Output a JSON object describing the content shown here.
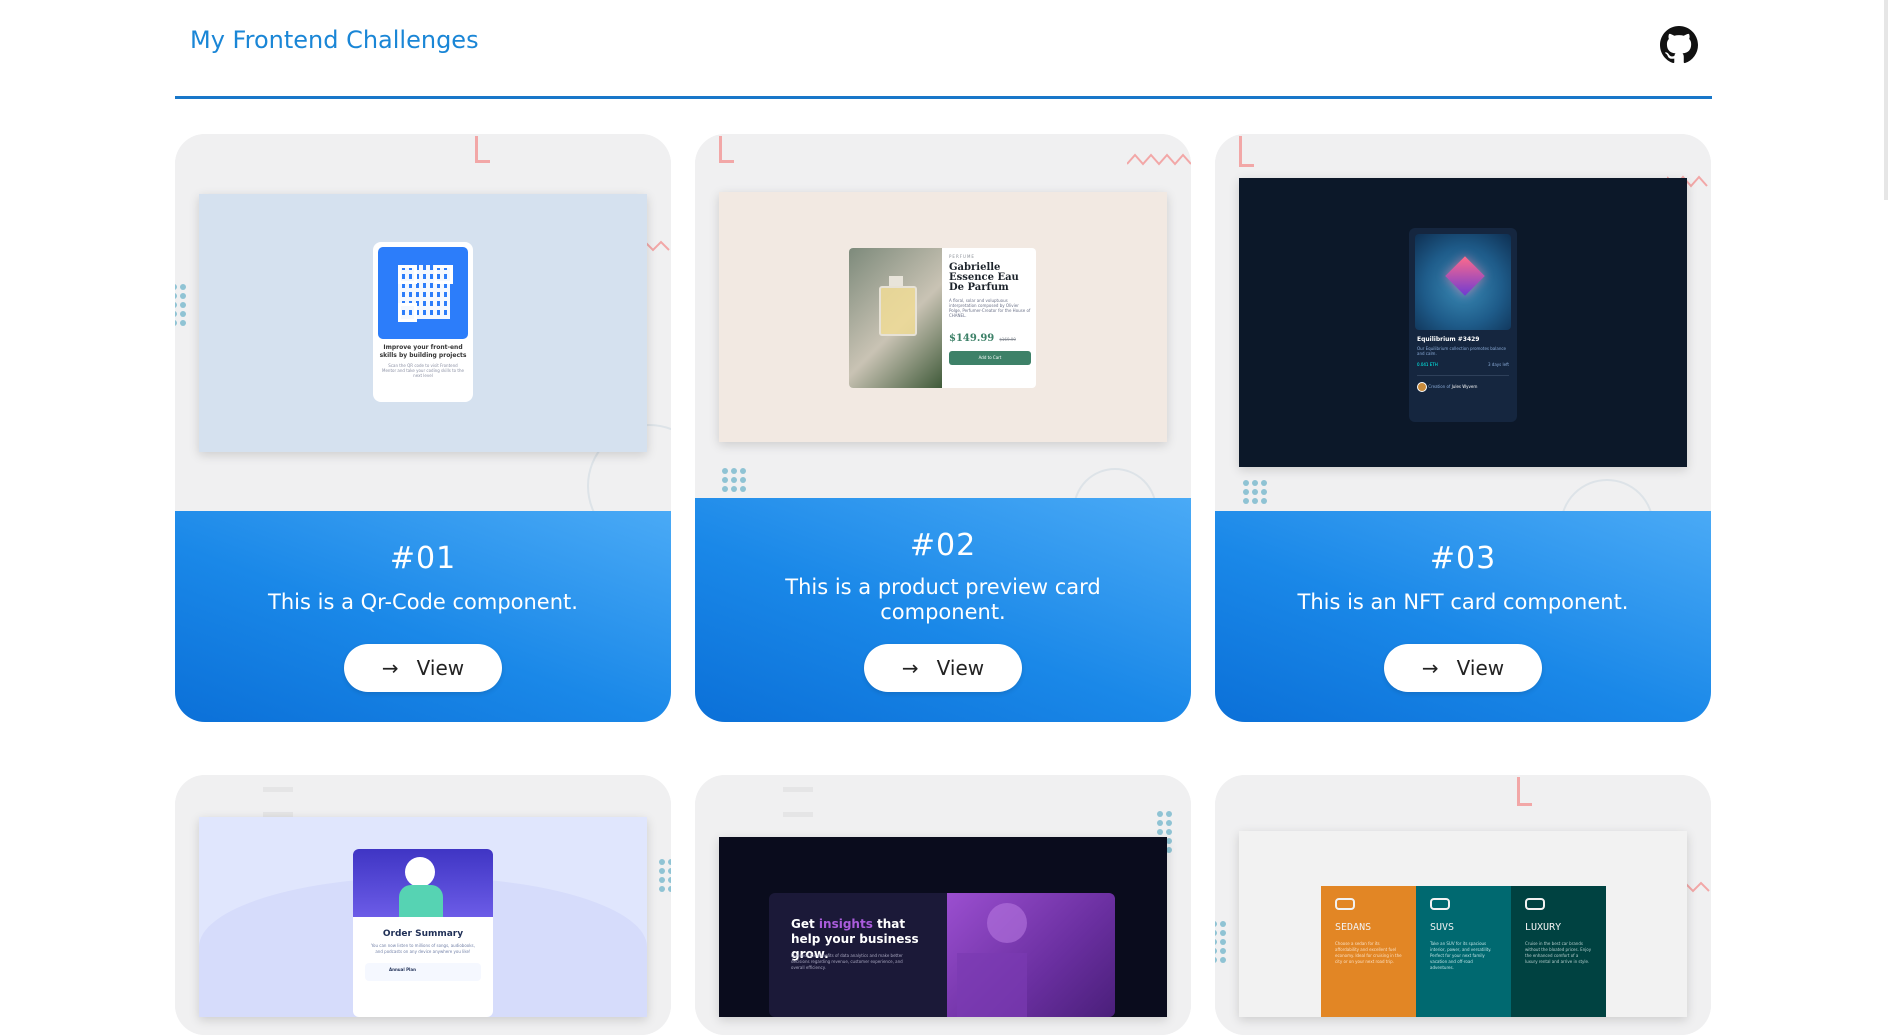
{
  "header": {
    "title": "My Frontend Challenges",
    "github_icon": "github-icon"
  },
  "cards": [
    {
      "number": "#01",
      "description": "This is a Qr-Code component.",
      "button_label": "View",
      "button_icon": "→",
      "preview": {
        "heading": "Improve your front-end skills by building projects",
        "text": "Scan the QR code to visit Frontend Mentor and take your coding skills to the next level"
      }
    },
    {
      "number": "#02",
      "description": "This is a product preview card component.",
      "button_label": "View",
      "button_icon": "→",
      "preview": {
        "category": "PERFUME",
        "name": "Gabrielle Essence Eau De Parfum",
        "text": "A floral, solar and voluptuous interpretation composed by Olivier Polge, Perfumer-Creator for the House of CHANEL.",
        "price": "$149.99",
        "old_price": "$169.99",
        "cta": "Add to Cart"
      }
    },
    {
      "number": "#03",
      "description": "This is an NFT card component.",
      "button_label": "View",
      "button_icon": "→",
      "preview": {
        "title": "Equilibrium #3429",
        "text": "Our Equilibrium collection promotes balance and calm.",
        "price": "0.041 ETH",
        "time": "3 days left",
        "creator_prefix": "Creation of",
        "creator": "Jules Wyvern"
      }
    },
    {
      "preview": {
        "title": "Order Summary",
        "text": "You can now listen to millions of songs, audiobooks, and podcasts on any device anywhere you like!",
        "plan": "Annual Plan"
      }
    },
    {
      "preview": {
        "heading_pre": "Get ",
        "heading_accent": "insights",
        "heading_post": " that help your business grow.",
        "text": "Discover the benefits of data analytics and make better decisions regarding revenue, customer experience, and overall efficiency."
      }
    },
    {
      "preview": {
        "col1": "SEDANS",
        "col2": "SUVS",
        "col3": "LUXURY",
        "text1": "Choose a sedan for its affordability and excellent fuel economy. Ideal for cruising in the city or on your next road trip.",
        "text2": "Take an SUV for its spacious interior, power, and versatility. Perfect for your next family vacation and off-road adventures.",
        "text3": "Cruise in the best car brands without the bloated prices. Enjoy the enhanced comfort of a luxury rental and arrive in style."
      }
    }
  ]
}
